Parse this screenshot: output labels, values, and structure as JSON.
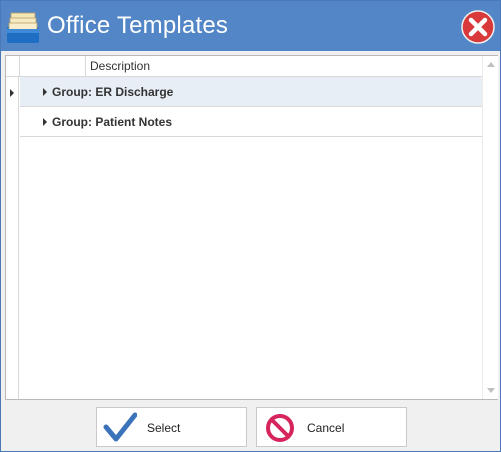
{
  "window": {
    "title": "Office Templates",
    "accent_color": "#5286c6"
  },
  "grid": {
    "columns": [
      "",
      "Description"
    ],
    "groups": [
      {
        "label": "Group: ER Discharge",
        "selected": true
      },
      {
        "label": "Group: Patient Notes",
        "selected": false
      }
    ]
  },
  "buttons": {
    "select_label": "Select",
    "cancel_label": "Cancel"
  },
  "icons": {
    "app": "stacked-documents-icon",
    "close": "close-icon",
    "select": "checkmark-icon",
    "cancel": "prohibited-icon"
  }
}
